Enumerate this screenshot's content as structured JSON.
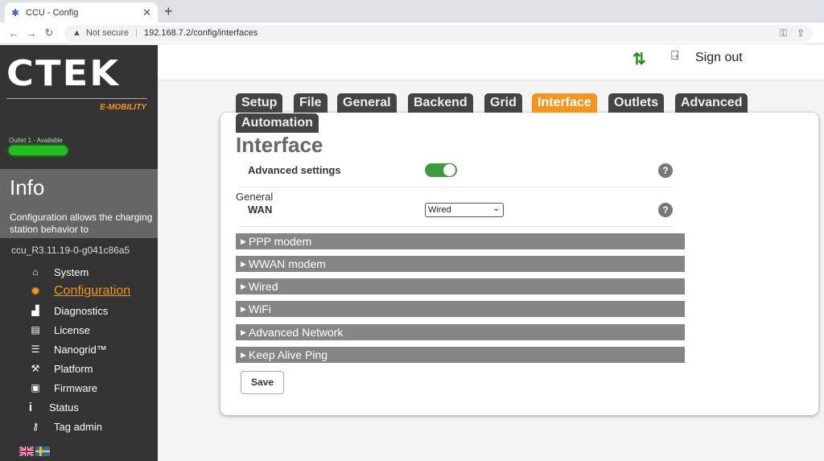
{
  "browser": {
    "tab_title": "CCU - Config",
    "not_secure": "Not secure",
    "url": "192.168.7.2/config/interfaces"
  },
  "sidebar": {
    "logo_text": "CTEK",
    "logo_sub": "E-MOBILITY",
    "outlet_status": "Outlet 1 - Available",
    "info_title": "Info",
    "info_description": "Configuration allows the charging station behavior to",
    "version": "ccu_R3.11.19-0-g041c86a5",
    "menu": [
      {
        "label": "System",
        "icon": "home-icon"
      },
      {
        "label": "Configuration",
        "icon": "gear-icon",
        "active": true
      },
      {
        "label": "Diagnostics",
        "icon": "bar-chart-icon"
      },
      {
        "label": "License",
        "icon": "license-icon"
      },
      {
        "label": "Nanogrid™",
        "icon": "sliders-icon"
      },
      {
        "label": "Platform",
        "icon": "wrench-icon"
      },
      {
        "label": "Firmware",
        "icon": "upload-folder-icon"
      },
      {
        "label": "Status",
        "icon": "info-icon"
      },
      {
        "label": "Tag admin",
        "icon": "key-icon"
      }
    ],
    "languages": [
      "en",
      "sv"
    ]
  },
  "header": {
    "sign_out": "Sign out"
  },
  "config_tabs": [
    "Setup",
    "File",
    "General",
    "Backend",
    "Grid",
    "Interface",
    "Outlets",
    "Advanced",
    "Automation"
  ],
  "active_tab": "Interface",
  "content": {
    "title": "Interface",
    "advanced_settings_label": "Advanced settings",
    "advanced_settings_on": true,
    "general_heading": "General",
    "wan_label": "WAN",
    "wan_value": "Wired",
    "help_glyph": "?",
    "sections": [
      "PPP modem",
      "WWAN modem",
      "Wired",
      "WiFi",
      "Advanced Network",
      "Keep Alive Ping"
    ],
    "save_label": "Save"
  },
  "colors": {
    "accent": "#f7941d",
    "sidebar_bg": "#333333",
    "toggle_on": "#3d9b3d",
    "outlet_available": "#22c01e"
  }
}
